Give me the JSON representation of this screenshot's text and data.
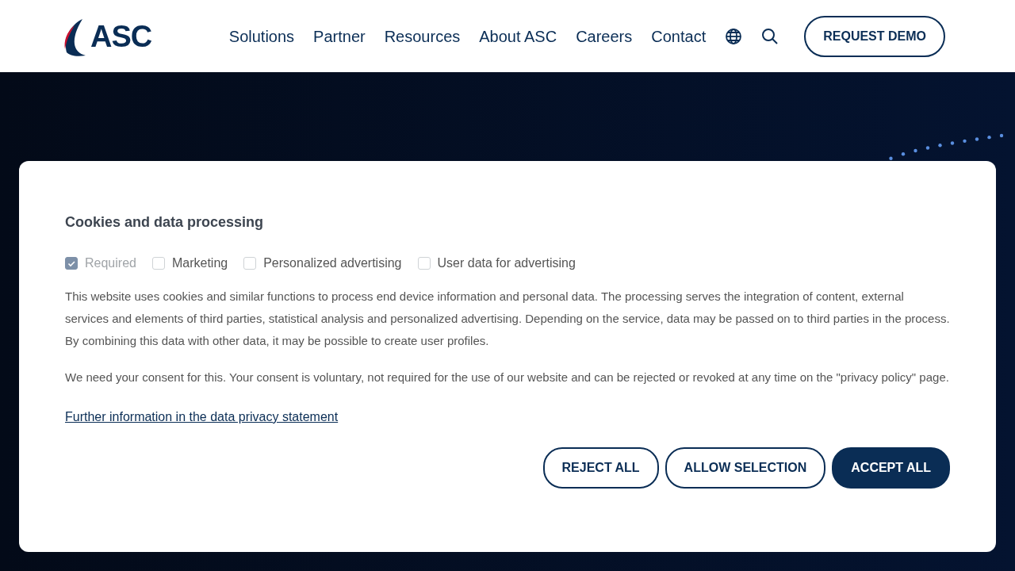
{
  "header": {
    "logo": "ASC",
    "nav": [
      "Solutions",
      "Partner",
      "Resources",
      "About ASC",
      "Careers",
      "Contact"
    ],
    "cta": "REQUEST DEMO"
  },
  "cookie_dialog": {
    "title": "Cookies and data processing",
    "options": [
      {
        "label": "Required",
        "checked": true,
        "disabled": true
      },
      {
        "label": "Marketing",
        "checked": false,
        "disabled": false
      },
      {
        "label": "Personalized advertising",
        "checked": false,
        "disabled": false
      },
      {
        "label": "User data for advertising",
        "checked": false,
        "disabled": false
      }
    ],
    "paragraphs": [
      "This website uses cookies and similar functions to process end device information and personal data. The processing serves the integration of content, external services and elements of third parties, statistical analysis and personalized advertising. Depending on the service, data may be passed on to third parties in the process. By combining this data with other data, it may be possible to create user profiles.",
      "We need your consent for this. Your consent is voluntary, not required for the use of our website and can be rejected or revoked at any time on the \"privacy policy\" page."
    ],
    "link": "Further information in the data privacy statement",
    "buttons": [
      {
        "label": "REJECT ALL",
        "kind": "outline"
      },
      {
        "label": "ALLOW SELECTION",
        "kind": "outline"
      },
      {
        "label": "ACCEPT ALL",
        "kind": "primary"
      }
    ]
  }
}
